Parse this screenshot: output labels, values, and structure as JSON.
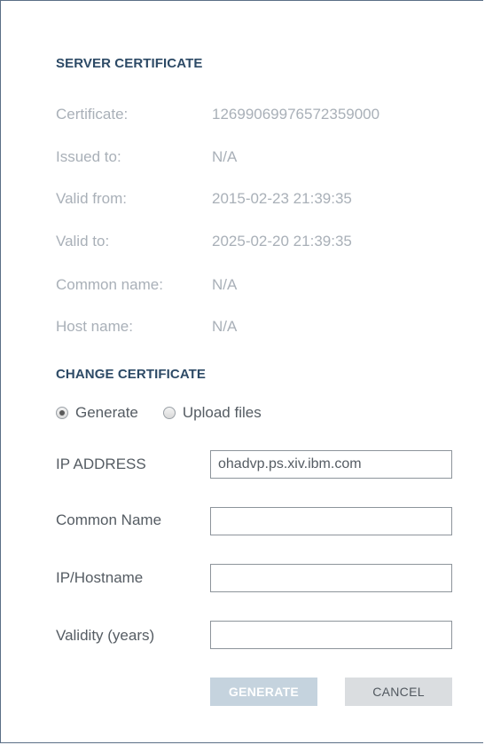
{
  "server_certificate": {
    "title": "SERVER CERTIFICATE",
    "rows": [
      {
        "label": "Certificate:",
        "value": "12699069976572359000"
      },
      {
        "label": "Issued to:",
        "value": "N/A"
      },
      {
        "label": "Valid from:",
        "value": "2015-02-23 21:39:35"
      },
      {
        "label": "Valid to:",
        "value": "2025-02-20 21:39:35"
      },
      {
        "label": "Common name:",
        "value": "N/A"
      },
      {
        "label": "Host name:",
        "value": "N/A"
      }
    ]
  },
  "change_certificate": {
    "title": "CHANGE CERTIFICATE",
    "options": [
      {
        "label": "Generate",
        "selected": true
      },
      {
        "label": "Upload files",
        "selected": false
      }
    ],
    "fields": [
      {
        "label": "IP ADDRESS",
        "value": "ohadvp.ps.xiv.ibm.com"
      },
      {
        "label": "Common Name",
        "value": ""
      },
      {
        "label": "IP/Hostname",
        "value": ""
      },
      {
        "label": "Validity (years)",
        "value": ""
      }
    ]
  },
  "buttons": {
    "generate_label": "GENERATE",
    "cancel_label": "CANCEL"
  }
}
